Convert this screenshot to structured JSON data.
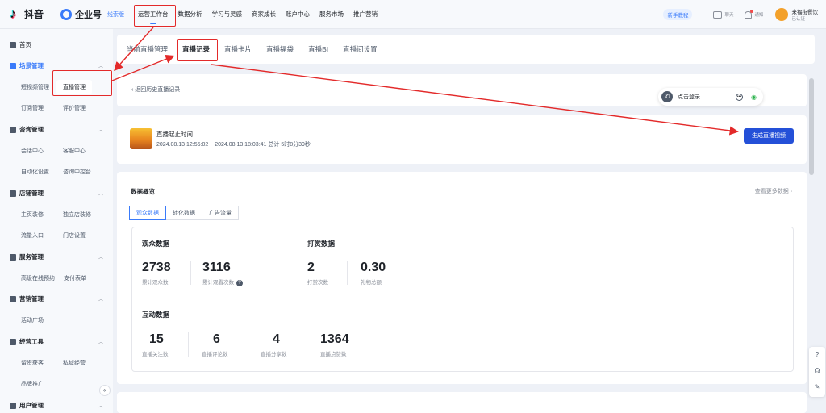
{
  "topbar": {
    "brand": "抖音",
    "product": "企业号",
    "version": "线索版",
    "nav": [
      "运营工作台",
      "数据分析",
      "学习与灵感",
      "商家成长",
      "账户中心",
      "服务市场",
      "推广营销"
    ],
    "newbie": "新手教程",
    "icons": [
      {
        "name": "chat-icon",
        "label": "聊天"
      },
      {
        "name": "bell-icon",
        "label": "通知"
      }
    ],
    "user": {
      "name": "来福街餐饮",
      "auth": "已认证"
    }
  },
  "sidebar": {
    "home": "首页",
    "groups": [
      {
        "label": "场景管理",
        "items": [
          "短视频管理",
          "直播管理",
          "订阅管理",
          "评价管理"
        ]
      },
      {
        "label": "咨询管理",
        "items": [
          "会话中心",
          "客服中心",
          "自动化设置",
          "咨询中控台"
        ]
      },
      {
        "label": "店铺管理",
        "items": [
          "主页装修",
          "独立店装修",
          "流量入口",
          "门店设置"
        ]
      },
      {
        "label": "服务管理",
        "items": [
          "高级在线预约",
          "支付表单"
        ]
      },
      {
        "label": "营销管理",
        "items": [
          "活动广场"
        ]
      },
      {
        "label": "经营工具",
        "items": [
          "留资获客",
          "私域经营",
          "品牌推广"
        ]
      },
      {
        "label": "用户管理",
        "items": []
      }
    ]
  },
  "tabs": [
    "当前直播管理",
    "直播记录",
    "直播卡片",
    "直播福袋",
    "直播BI",
    "直播间设置"
  ],
  "back_link": "返回历史直播记录",
  "phone_login": "点击登录",
  "live": {
    "title": "直播起止时间",
    "time": "2024.08.13 12:55:02 ~ 2024.08.13 18:03:41   总计 5时8分39秒",
    "generate_button": "生成直播视频"
  },
  "overview": {
    "title": "数据概览",
    "more": "查看更多数据 ›",
    "segments": [
      "观众数据",
      "转化数据",
      "广告流量"
    ],
    "groups": [
      {
        "title": "观众数据",
        "stats": [
          {
            "value": "2738",
            "label": "累计观众数"
          },
          {
            "value": "3116",
            "label": "累计观看次数"
          }
        ]
      },
      {
        "title": "打赏数据",
        "stats": [
          {
            "value": "2",
            "label": "打赏次数"
          },
          {
            "value": "0.30",
            "label": "礼物总额"
          }
        ]
      },
      {
        "title": "互动数据",
        "stats": [
          {
            "value": "15",
            "label": "直播关注数"
          },
          {
            "value": "6",
            "label": "直播评论数"
          },
          {
            "value": "4",
            "label": "直播分享数"
          },
          {
            "value": "1364",
            "label": "直播点赞数"
          }
        ]
      }
    ]
  },
  "colors": {
    "accent": "#3a7bfa",
    "button": "#2450d8",
    "annotation": "#e32a2a"
  }
}
